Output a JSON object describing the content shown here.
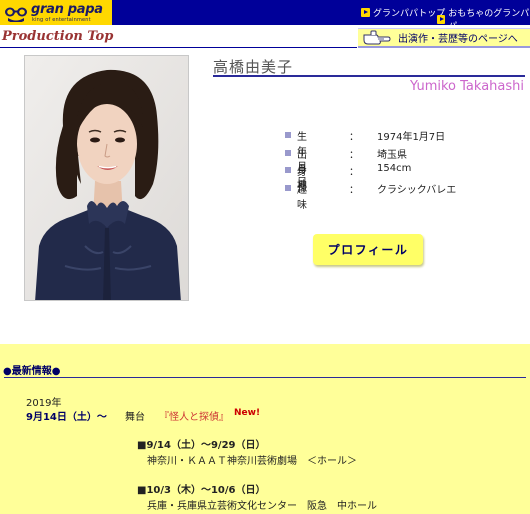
{
  "header": {
    "logo": {
      "name": "gran papa",
      "tagline": "king of entertainment"
    },
    "nav": [
      {
        "label": "グランパパトップ"
      },
      {
        "label": "おもちゃのグランパパ"
      }
    ]
  },
  "section": {
    "title": "Production Top",
    "works_link": "出演作・芸歴等のページへ"
  },
  "artist": {
    "name_jp": "高橋由美子",
    "name_en": "Yumiko Takahashi"
  },
  "profile": [
    {
      "label": "生年月日",
      "colon": "：",
      "value": "1974年1月7日"
    },
    {
      "label": "出身地",
      "colon": "：",
      "value": "埼玉県"
    },
    {
      "label": "身　長",
      "colon": "：",
      "value": "154cm"
    },
    {
      "label": "趣　　味",
      "colon": "：",
      "value": "クラシックバレエ"
    }
  ],
  "profile_button": "プロフィール",
  "news": {
    "heading": "●最新情報●",
    "year": "2019年",
    "date": "9月14日（土）～",
    "type": "舞台",
    "title": "『怪人と探偵』",
    "badge": "New!",
    "schedule": [
      {
        "dates": "■9/14（土）～9/29（日）",
        "venue": "神奈川・ＫＡＡＴ神奈川芸術劇場　＜ホール＞"
      },
      {
        "dates": "■10/3（木）～10/6（日）",
        "venue": "兵庫・兵庫県立芸術文化センター　阪急　中ホール"
      }
    ]
  },
  "colors": {
    "nav_bar": "#000099",
    "logo_bg": "#ffd800",
    "production_title": "#993333",
    "name_en": "#cc66cc",
    "news_bg": "#ffff99",
    "news_title": "#cc3333",
    "new_badge": "#cc0000"
  },
  "icons": [
    "glasses-logo-icon",
    "nav-arrow-icon",
    "pointing-hand-icon",
    "profile-bullet-icon"
  ]
}
